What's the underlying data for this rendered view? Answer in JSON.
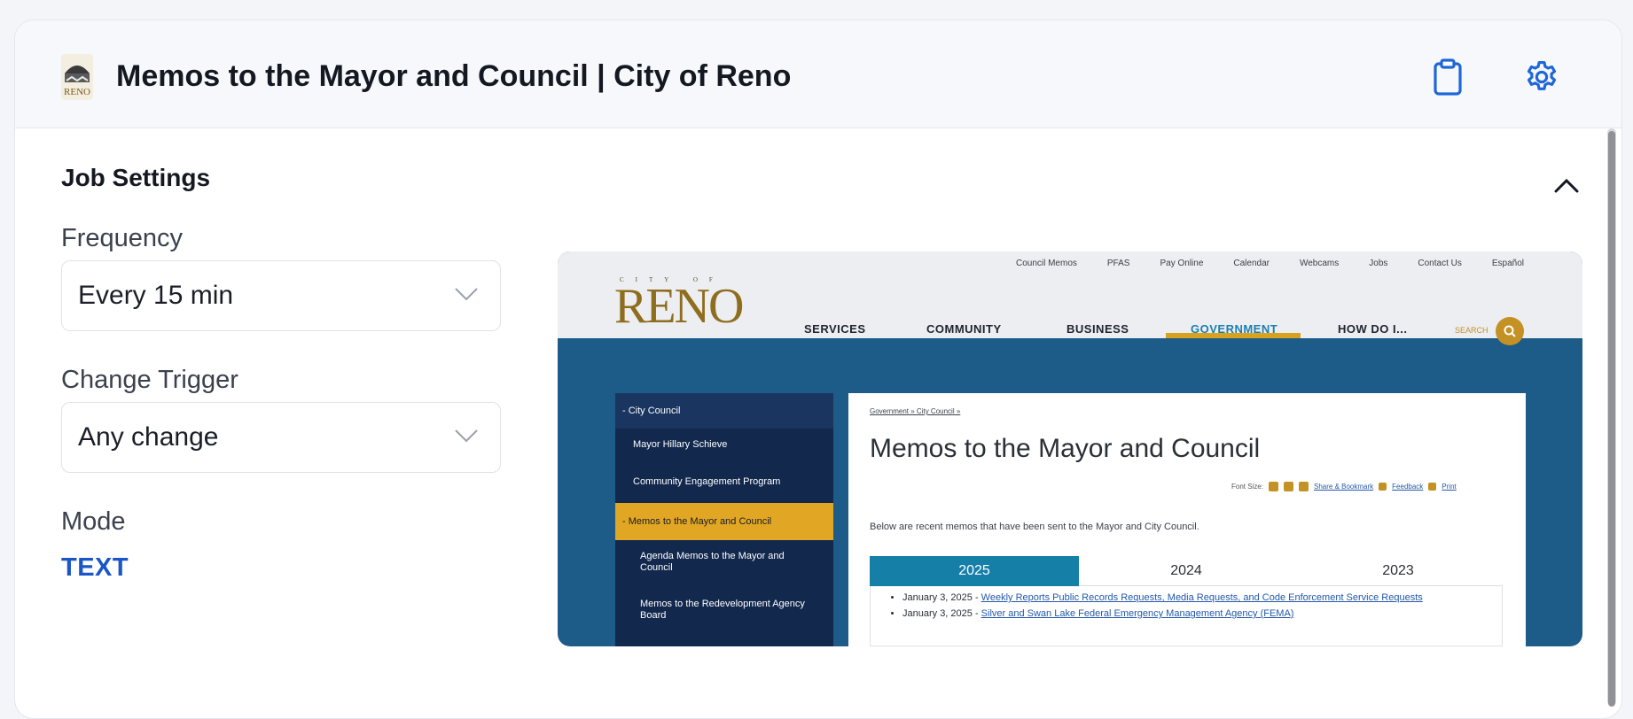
{
  "header": {
    "title": "Memos to the Mayor and Council | City of Reno",
    "site_icon": "reno-logo-icon",
    "clipboard_icon": "clipboard-icon",
    "settings_icon": "gear-icon"
  },
  "job_settings": {
    "title": "Job Settings",
    "collapse_icon": "chevron-up-icon",
    "frequency": {
      "label": "Frequency",
      "value": "Every 15 min"
    },
    "change_trigger": {
      "label": "Change Trigger",
      "value": "Any change"
    },
    "mode": {
      "label": "Mode",
      "value": "TEXT"
    }
  },
  "preview": {
    "utility_links": [
      "Council Memos",
      "PFAS",
      "Pay Online",
      "Calendar",
      "Webcams",
      "Jobs",
      "Contact Us",
      "Español"
    ],
    "logo_small": "CITY OF",
    "logo": "RENO",
    "nav": [
      "SERVICES",
      "COMMUNITY",
      "BUSINESS",
      "GOVERNMENT",
      "HOW DO I..."
    ],
    "search_label": "SEARCH",
    "sidebar": {
      "head": "- City Council",
      "items": [
        "Mayor Hillary Schieve",
        "Community Engagement Program",
        "- Memos to the Mayor and Council",
        "Agenda Memos to the Mayor and Council",
        "Memos to the Redevelopment Agency Board"
      ]
    },
    "breadcrumb": "Government » City Council »",
    "heading": "Memos to the Mayor and Council",
    "font_size_label": "Font Size:",
    "share": "Share & Bookmark",
    "feedback": "Feedback",
    "print": "Print",
    "intro": "Below are recent memos that have been sent to the Mayor and City Council.",
    "tabs": [
      "2025",
      "2024",
      "2023"
    ],
    "memos": [
      {
        "date": "January 3, 2025 - ",
        "title": "Weekly Reports Public Records Requests, Media Requests, and Code Enforcement Service Requests"
      },
      {
        "date": "January 3, 2025 - ",
        "title": "Silver and Swan Lake Federal Emergency Management Agency (FEMA)"
      }
    ]
  },
  "colors": {
    "accent_blue": "#1a56c8",
    "reno_gold": "#c49124",
    "reno_navy": "#12284d",
    "tab_blue": "#157fa8"
  }
}
